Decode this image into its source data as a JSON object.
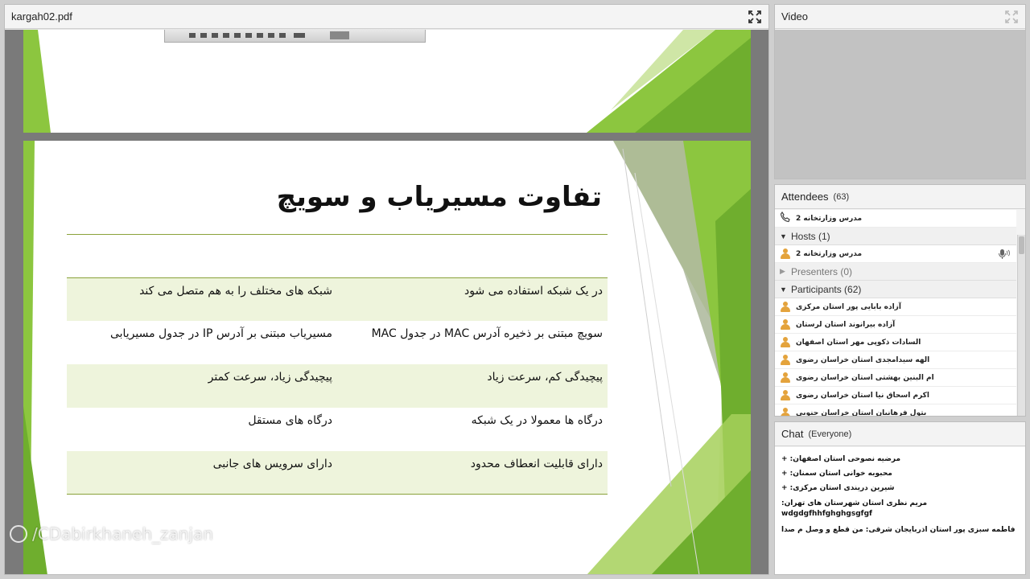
{
  "document": {
    "filename": "kargah02.pdf",
    "slide_title": "تفاوت مسیریاب و سویچ",
    "rows": [
      {
        "switch": "در یک شبکه استفاده می شود",
        "router": "شبکه های مختلف را به هم متصل می کند"
      },
      {
        "switch": "سویچ مبتنی بر ذخیره آدرس MAC در جدول MAC",
        "router": "مسیریاب مبتنی بر آدرس IP در جدول مسیریابی"
      },
      {
        "switch": "پیچیدگی کم، سرعت زیاد",
        "router": "پیچیدگی زیاد، سرعت کمتر"
      },
      {
        "switch": "درگاه ها معمولا در یک شبکه",
        "router": "درگاه های مستقل"
      },
      {
        "switch": "دارای قابلیت انعطاف محدود",
        "router": "دارای سرویس های جانبی"
      }
    ]
  },
  "video": {
    "title": "Video"
  },
  "attendees": {
    "title": "Attendees",
    "count": "(63)",
    "caller": "مدرس وزارتخانه 2",
    "hosts_label": "Hosts (1)",
    "host": "مدرس وزارتخانه 2",
    "presenters_label": "Presenters (0)",
    "participants_label": "Participants (62)",
    "participants": [
      "آزاده بابایی پور استان مرکزی",
      "آزاده بیرانوند استان لرستان",
      "السادات ذکوپی مهر استان اصفهان",
      "الهه سیدامجدی استان خراسان رضوی",
      "ام البنین بهشتی استان خراسان رضوی",
      "اکرم اسحاق نیا استان خراسان رضوی",
      "بتول فرهانیان استان خراسان جنوبی"
    ]
  },
  "chat": {
    "title": "Chat",
    "scope": "(Everyone)",
    "messages": [
      "مرضیه نصوحی استان اصفهان: +",
      "محبوبه خوانی استان سمنان: +",
      "شیرین دریندی استان مرکزی: +",
      "مریم نظری استان شهرستان های تهران: wdgdgfhhfghghgsgfgf",
      "فاطمه سبزی پور استان آذربایجان شرقی: من قطع و وصل م صدا"
    ]
  },
  "watermark": "/CDabirkhaneh_zanjan",
  "colors": {
    "green_dark": "#6fae2e",
    "green_light": "#a6d05a",
    "accent_rule": "#8aa23a"
  }
}
